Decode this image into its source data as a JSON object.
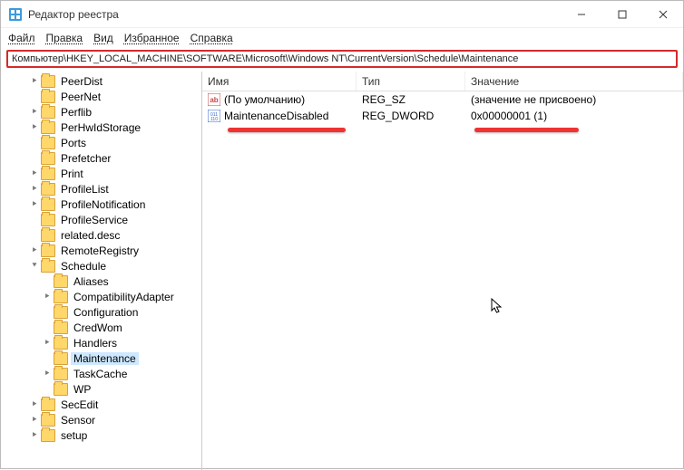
{
  "window": {
    "title": "Редактор реестра"
  },
  "menu": {
    "file": "Файл",
    "edit": "Правка",
    "view": "Вид",
    "favorites": "Избранное",
    "help": "Справка"
  },
  "address": "Компьютер\\HKEY_LOCAL_MACHINE\\SOFTWARE\\Microsoft\\Windows NT\\CurrentVersion\\Schedule\\Maintenance",
  "tree": [
    {
      "label": "PeerDist",
      "depth": 2,
      "twisty": ">"
    },
    {
      "label": "PeerNet",
      "depth": 2,
      "twisty": ""
    },
    {
      "label": "Perflib",
      "depth": 2,
      "twisty": ">"
    },
    {
      "label": "PerHwIdStorage",
      "depth": 2,
      "twisty": ">"
    },
    {
      "label": "Ports",
      "depth": 2,
      "twisty": ""
    },
    {
      "label": "Prefetcher",
      "depth": 2,
      "twisty": ""
    },
    {
      "label": "Print",
      "depth": 2,
      "twisty": ">"
    },
    {
      "label": "ProfileList",
      "depth": 2,
      "twisty": ">"
    },
    {
      "label": "ProfileNotification",
      "depth": 2,
      "twisty": ">"
    },
    {
      "label": "ProfileService",
      "depth": 2,
      "twisty": ""
    },
    {
      "label": "related.desc",
      "depth": 2,
      "twisty": ""
    },
    {
      "label": "RemoteRegistry",
      "depth": 2,
      "twisty": ">"
    },
    {
      "label": "Schedule",
      "depth": 2,
      "twisty": "v",
      "expanded": true
    },
    {
      "label": "Aliases",
      "depth": 3,
      "twisty": ""
    },
    {
      "label": "CompatibilityAdapter",
      "depth": 3,
      "twisty": ">"
    },
    {
      "label": "Configuration",
      "depth": 3,
      "twisty": ""
    },
    {
      "label": "CredWom",
      "depth": 3,
      "twisty": ""
    },
    {
      "label": "Handlers",
      "depth": 3,
      "twisty": ">"
    },
    {
      "label": "Maintenance",
      "depth": 3,
      "twisty": "",
      "selected": true
    },
    {
      "label": "TaskCache",
      "depth": 3,
      "twisty": ">"
    },
    {
      "label": "WP",
      "depth": 3,
      "twisty": ""
    },
    {
      "label": "SecEdit",
      "depth": 2,
      "twisty": ">"
    },
    {
      "label": "Sensor",
      "depth": 2,
      "twisty": ">"
    },
    {
      "label": "setup",
      "depth": 2,
      "twisty": ">"
    }
  ],
  "columns": {
    "name": "Имя",
    "type": "Тип",
    "value": "Значение"
  },
  "values": [
    {
      "icon": "sz",
      "name": "(По умолчанию)",
      "type": "REG_SZ",
      "value": "(значение не присвоено)"
    },
    {
      "icon": "dw",
      "name": "MaintenanceDisabled",
      "type": "REG_DWORD",
      "value": "0x00000001 (1)"
    }
  ]
}
